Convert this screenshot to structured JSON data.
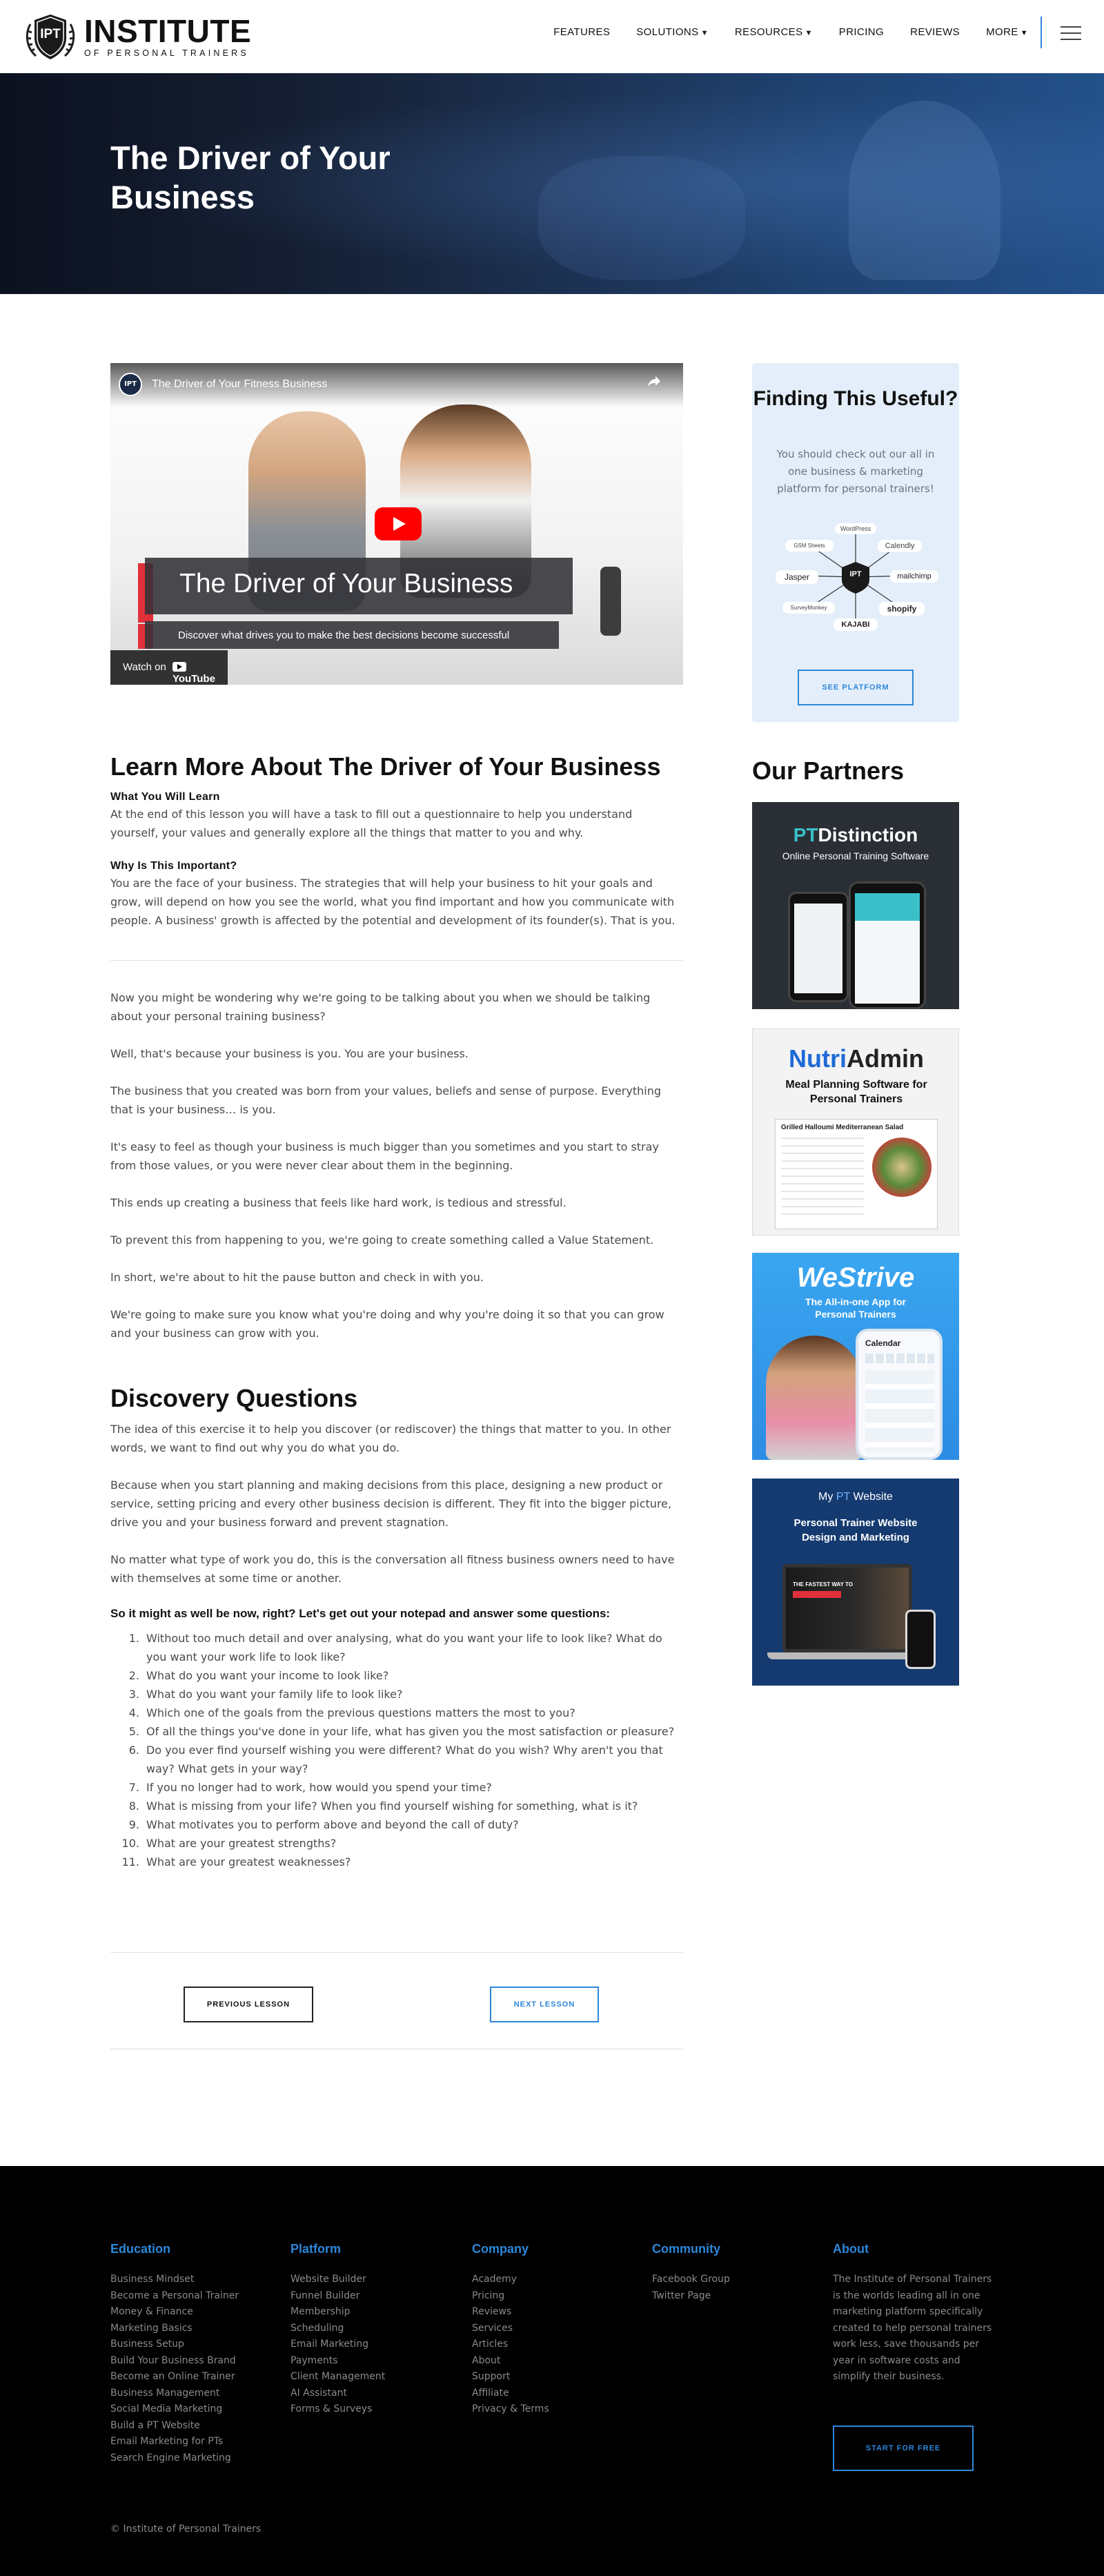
{
  "header": {
    "logo_badge": "IPT",
    "logo_title": "INSTITUTE",
    "logo_sub": "OF PERSONAL TRAINERS",
    "nav": [
      {
        "label": "FEATURES",
        "caret": ""
      },
      {
        "label": "SOLUTIONS",
        "caret": "▼"
      },
      {
        "label": "RESOURCES",
        "caret": "▼"
      },
      {
        "label": "PRICING",
        "caret": ""
      },
      {
        "label": "REVIEWS",
        "caret": ""
      },
      {
        "label": "MORE",
        "caret": "▼"
      }
    ],
    "menu_icon": "hamburger-icon"
  },
  "hero": {
    "title": "The Driver of Your Business"
  },
  "video": {
    "title": "The Driver of Your Fitness Business",
    "caption": "The Driver of Your Business",
    "subcaption": "Discover what drives you to make the best decisions become successful",
    "watch_on": "Watch on",
    "platform": "YouTube"
  },
  "article": {
    "heading": "Learn More About The Driver of Your Business",
    "learn_label": "What You Will Learn",
    "learn_text": "At the end of this lesson you will have a task to fill out a questionnaire to help you understand yourself, your values and generally explore all the things that matter to you and why.",
    "why_label": "Why Is This Important?",
    "why_text": "You are the face of your business. The strategies that will help your business to hit your goals and grow, will depend on how you see the world, what you find important and how you communicate with people. A business' growth is affected by the potential and development of its founder(s). That is you.",
    "paragraphs": [
      "Now you might be wondering why we're going to be talking about you when we should be talking about your personal training business?",
      "Well, that's because your business is you. You are your business.",
      "The business that you created was born from your values, beliefs and sense of purpose. Everything that is your business… is you.",
      "It's easy to feel as though your business is much bigger than you sometimes and you start to stray from those values, or you were never clear about them in the beginning.",
      "This ends up creating a business that feels like hard work, is tedious and stressful.",
      "To prevent this from happening to you, we're going to create something called a Value Statement.",
      "In short, we're about to hit the pause button and check in with you.",
      "We're going to make sure you know what you're doing and why you're doing it so that you can grow and your business can grow with you."
    ],
    "discovery_heading": "Discovery Questions",
    "discovery_paragraphs": [
      "The idea of this exercise it to help you discover (or rediscover) the things that matter to you. In other words, we want to find out why you do what you do.",
      "Because when you start planning and making decisions from this place, designing a new product or service, setting pricing and every other business decision is different. They fit into the bigger picture, drive you and your business forward and prevent stagnation.",
      "No matter what type of work you do, this is the conversation all fitness business owners need to have with themselves at some time or another."
    ],
    "questions_intro": "So it might as well be now, right? Let's get out your notepad and answer some questions:",
    "questions": [
      "Without too much detail and over analysing, what do you want your life to look like? What do you want your work life to look like?",
      "What do you want your income to look like?",
      "What do you want your family life to look like?",
      "Which one of the goals from the previous questions matters the most to you?",
      "Of all the things you've done in your life, what has given you the most satisfaction or pleasure?",
      "Do you ever find yourself wishing you were different? What do you wish? Why aren't you that way? What gets in your way?",
      "If you no longer had to work, how would you spend your time?",
      "What is missing from your life? When you find yourself wishing for something, what is it?",
      "What motivates you to perform above and beyond the call of duty?",
      "What are your greatest strengths?",
      "What are your greatest weaknesses?"
    ],
    "prev_label": "PREVIOUS LESSON",
    "next_label": "NEXT LESSON"
  },
  "sidebar": {
    "promo_title": "Finding This Useful?",
    "promo_text": "You should check out our all in one business & marketing platform for personal trainers!",
    "promo_hub": "IPT",
    "promo_logos": [
      "WordPress",
      "Calendly",
      "mailchimp",
      "shopify",
      "KAJABI",
      "SurveyMonkey",
      "Jasper",
      "GSM Sheets"
    ],
    "promo_button": "SEE PLATFORM",
    "partners_title": "Our Partners",
    "partners": [
      {
        "brand_a": "PT",
        "brand_b": "Distinction",
        "tagline": "Online Personal Training Software"
      },
      {
        "brand_a": "Nutri",
        "brand_b": "Admin",
        "tagline": "Meal Planning Software for Personal Trainers",
        "card_title": "Grilled Halloumi Mediterranean Salad"
      },
      {
        "brand_a": "WeStrive",
        "tagline": "The All-in-one App for Personal Trainers",
        "app_label": "Calendar"
      },
      {
        "brand_a": "My",
        "brand_b": "PT",
        "brand_c": "Website",
        "tagline": "Personal Trainer Website Design and Marketing",
        "screen_text": "THE FASTEST WAY TO"
      }
    ]
  },
  "footer": {
    "columns": [
      {
        "heading": "Education",
        "links": [
          "Business Mindset",
          "Become a Personal Trainer",
          "Money & Finance",
          "Marketing Basics",
          "Business Setup",
          "Build Your Business Brand",
          "Become an Online Trainer",
          "Business Management",
          "Social Media Marketing",
          "Build a PT Website",
          "Email Marketing for PTs",
          "Search Engine Marketing"
        ]
      },
      {
        "heading": "Platform",
        "links": [
          "Website Builder",
          "Funnel Builder",
          "Membership",
          "Scheduling",
          "Email Marketing",
          "Payments",
          "Client Management",
          "AI Assistant",
          "Forms & Surveys"
        ]
      },
      {
        "heading": "Company",
        "links": [
          "Academy",
          "Pricing",
          "Reviews",
          "Services",
          "Articles",
          "About",
          "Support",
          "Affiliate",
          "Privacy & Terms"
        ]
      },
      {
        "heading": "Community",
        "links": [
          "Facebook Group",
          "Twitter Page"
        ]
      }
    ],
    "about_heading": "About",
    "about_text": "The Institute of Personal Trainers is the worlds leading all in one marketing platform specifically created to help personal trainers work less, save thousands per year in software costs and simplify their business.",
    "cta": "START FOR FREE",
    "copyright": "© Institute of Personal Trainers"
  },
  "colors": {
    "accent": "#2d86d9",
    "footer_bg": "#000000",
    "promo_bg": "#e3eefa"
  }
}
